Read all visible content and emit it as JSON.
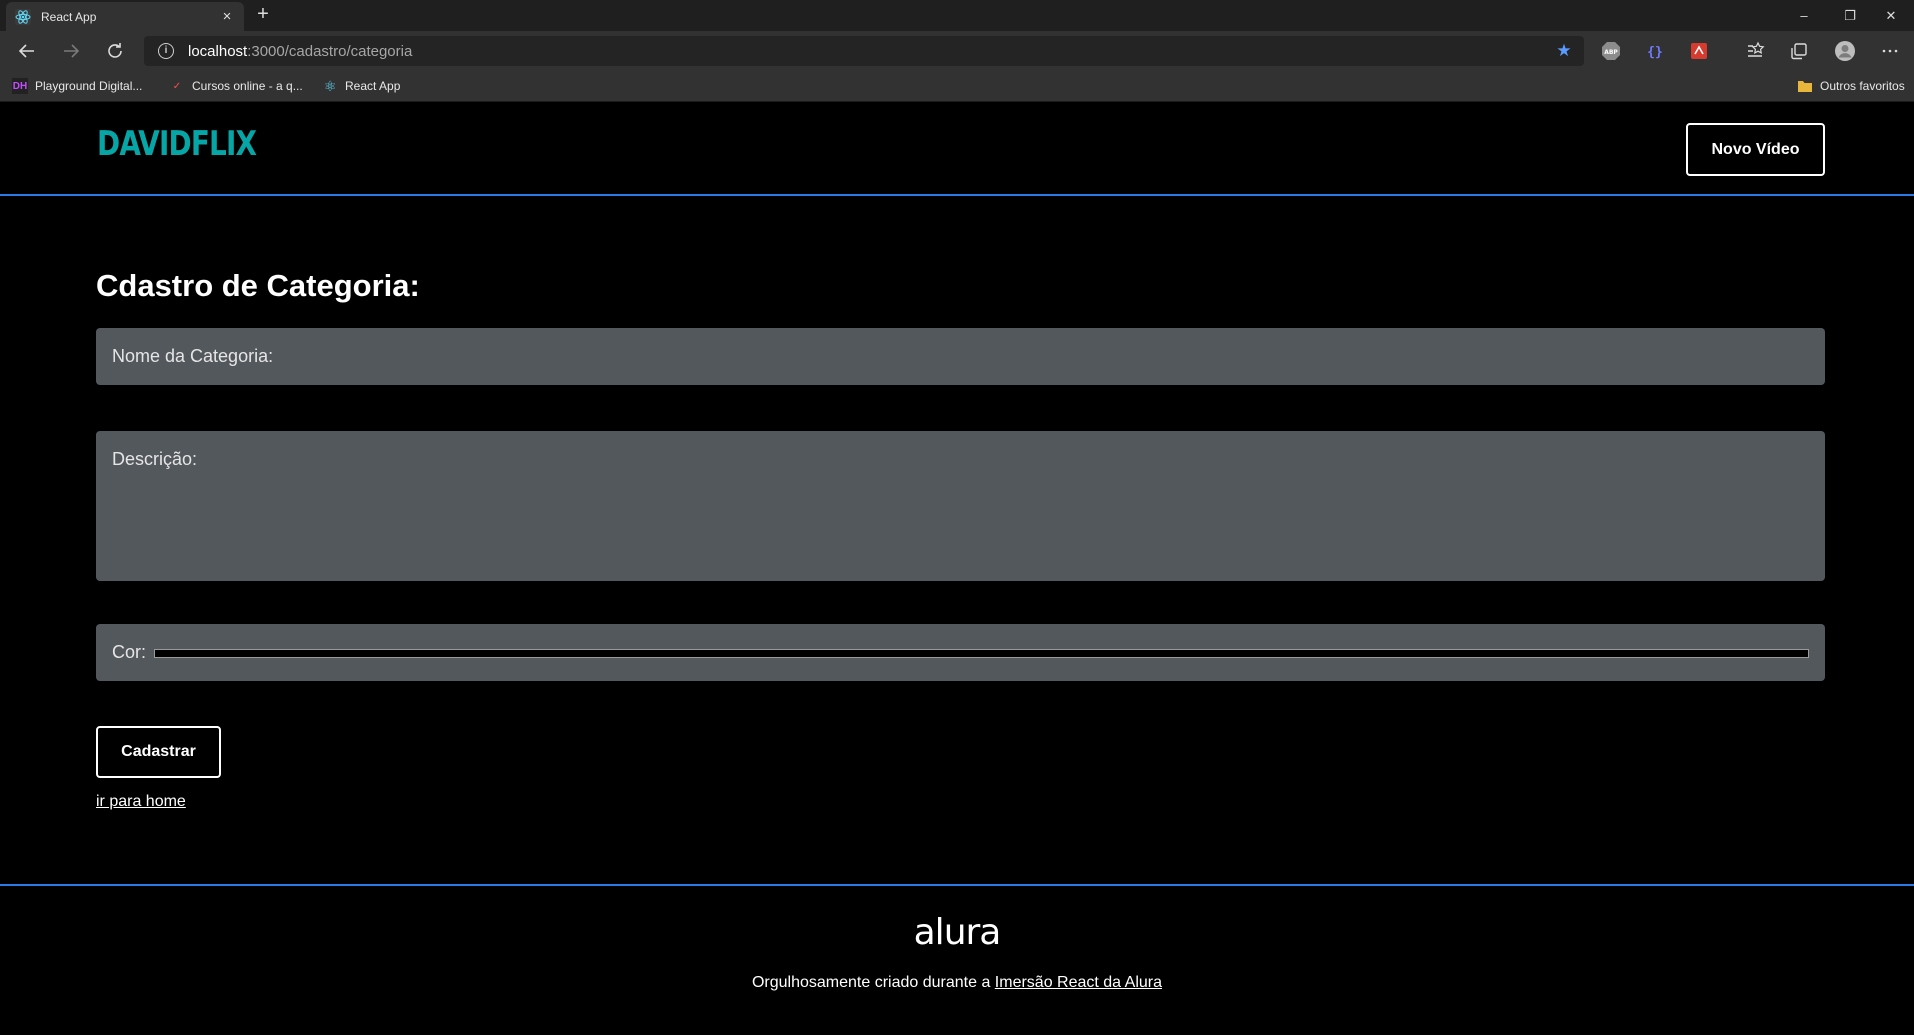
{
  "browser": {
    "tab_title": "React App",
    "tab_close": "×",
    "new_tab": "+",
    "url_host": "localhost",
    "url_rest": ":3000/cadastro/categoria",
    "window_controls": {
      "minimize": "–",
      "restore": "❐",
      "close": "✕"
    },
    "bookmarks": [
      {
        "label": "Playground Digital...",
        "icon": "DH"
      },
      {
        "label": "Cursos online - a q...",
        "icon": "✓"
      },
      {
        "label": "React App",
        "icon": "⚛"
      }
    ],
    "other_favorites": "Outros favoritos"
  },
  "header": {
    "logo": "DAVIDFLIX",
    "new_video_button": "Novo Vídeo"
  },
  "form": {
    "title": "Cdastro de Categoria:",
    "name_label": "Nome da Categoria:",
    "description_label": "Descrição:",
    "color_label": "Cor:",
    "color_value": "#000000",
    "submit_label": "Cadastrar",
    "home_link": "ir para home"
  },
  "footer": {
    "logo": "alura",
    "credit_text": "Orgulhosamente criado durante a ",
    "credit_link": "Imersão React da Alura"
  },
  "colors": {
    "accent_blue": "#2a7ae4",
    "logo_teal": "#07a6a6",
    "field_bg": "#53585d"
  }
}
